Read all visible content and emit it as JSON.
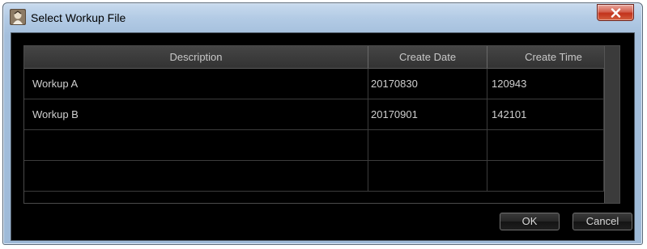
{
  "window": {
    "title": "Select Workup File",
    "icon": "app-icon",
    "close_icon": "close-icon"
  },
  "table": {
    "columns": [
      "Description",
      "Create Date",
      "Create Time"
    ],
    "rows": [
      [
        "Workup A",
        "20170830",
        "120943"
      ],
      [
        "Workup B",
        "20170901",
        "142101"
      ],
      [
        "",
        "",
        ""
      ],
      [
        "",
        "",
        ""
      ]
    ]
  },
  "buttons": {
    "ok_label": "OK",
    "cancel_label": "Cancel"
  },
  "colors": {
    "titlebar": "#b3cbe5",
    "client_background": "#000000",
    "header_text": "#c8c8c8",
    "close_button": "#c2321b"
  }
}
